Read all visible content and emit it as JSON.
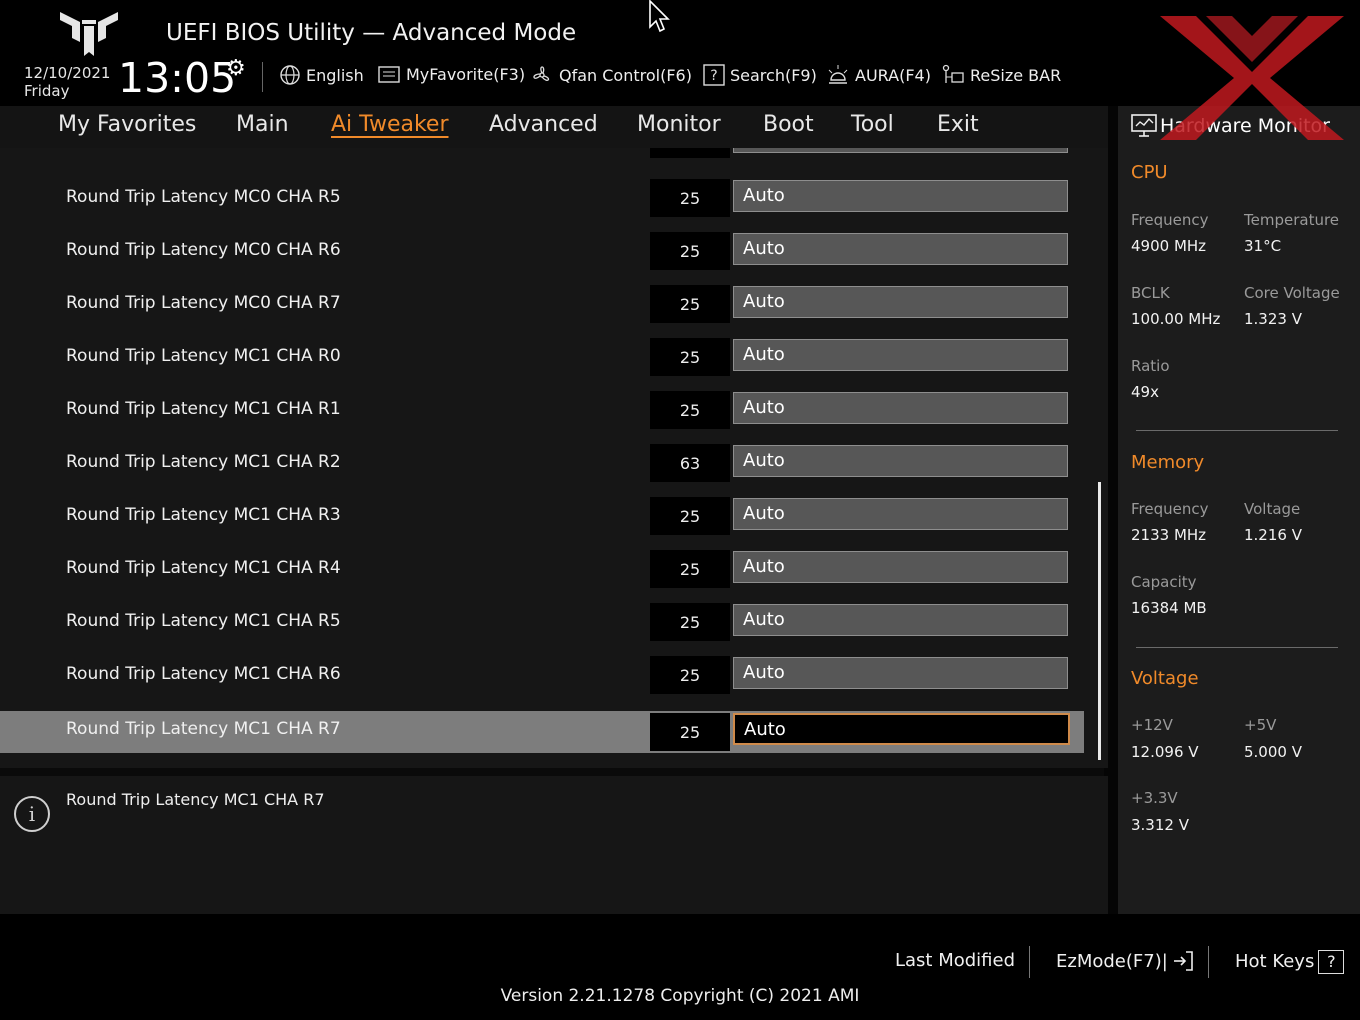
{
  "header": {
    "title": "UEFI BIOS Utility — Advanced Mode",
    "date": "12/10/2021",
    "day": "Friday",
    "time": "13:05",
    "toolbar": [
      {
        "label": "English",
        "icon": "globe-icon"
      },
      {
        "label": "MyFavorite(F3)",
        "icon": "favorite-list-icon"
      },
      {
        "label": "Qfan Control(F6)",
        "icon": "fan-icon"
      },
      {
        "label": "Search(F9)",
        "icon": "search-question-icon"
      },
      {
        "label": "AURA(F4)",
        "icon": "aura-light-icon"
      },
      {
        "label": "ReSize BAR",
        "icon": "resize-bar-icon"
      }
    ]
  },
  "tabs": [
    {
      "label": "My Favorites",
      "active": false
    },
    {
      "label": "Main",
      "active": false
    },
    {
      "label": "Ai Tweaker",
      "active": true
    },
    {
      "label": "Advanced",
      "active": false
    },
    {
      "label": "Monitor",
      "active": false
    },
    {
      "label": "Boot",
      "active": false
    },
    {
      "label": "Tool",
      "active": false
    },
    {
      "label": "Exit",
      "active": false
    }
  ],
  "settings": [
    {
      "label": "Round Trip Latency MC0 CHA R5",
      "current": "25",
      "value": "Auto"
    },
    {
      "label": "Round Trip Latency MC0 CHA R6",
      "current": "25",
      "value": "Auto"
    },
    {
      "label": "Round Trip Latency MC0 CHA R7",
      "current": "25",
      "value": "Auto"
    },
    {
      "label": "Round Trip Latency MC1 CHA R0",
      "current": "25",
      "value": "Auto"
    },
    {
      "label": "Round Trip Latency MC1 CHA R1",
      "current": "25",
      "value": "Auto"
    },
    {
      "label": "Round Trip Latency MC1 CHA R2",
      "current": "63",
      "value": "Auto"
    },
    {
      "label": "Round Trip Latency MC1 CHA R3",
      "current": "25",
      "value": "Auto"
    },
    {
      "label": "Round Trip Latency MC1 CHA R4",
      "current": "25",
      "value": "Auto"
    },
    {
      "label": "Round Trip Latency MC1 CHA R5",
      "current": "25",
      "value": "Auto"
    },
    {
      "label": "Round Trip Latency MC1 CHA R6",
      "current": "25",
      "value": "Auto"
    },
    {
      "label": "Round Trip Latency MC1 CHA R7",
      "current": "25",
      "value": "Auto",
      "selected": true
    }
  ],
  "help_text": "Round Trip Latency MC1 CHA R7",
  "hardware_monitor": {
    "title": "Hardware Monitor",
    "cpu": {
      "heading": "CPU",
      "frequency_label": "Frequency",
      "frequency": "4900 MHz",
      "temperature_label": "Temperature",
      "temperature": "31°C",
      "bclk_label": "BCLK",
      "bclk": "100.00 MHz",
      "core_voltage_label": "Core Voltage",
      "core_voltage": "1.323 V",
      "ratio_label": "Ratio",
      "ratio": "49x"
    },
    "memory": {
      "heading": "Memory",
      "frequency_label": "Frequency",
      "frequency": "2133 MHz",
      "voltage_label": "Voltage",
      "voltage": "1.216 V",
      "capacity_label": "Capacity",
      "capacity": "16384 MB"
    },
    "voltage": {
      "heading": "Voltage",
      "v12_label": "+12V",
      "v12": "12.096 V",
      "v5_label": "+5V",
      "v5": "5.000 V",
      "v33_label": "+3.3V",
      "v33": "3.312 V"
    }
  },
  "footer": {
    "last_modified": "Last Modified",
    "ezmode": "EzMode(F7)|",
    "hotkeys": "Hot Keys",
    "hotkeys_box": "?",
    "version": "Version 2.21.1278 Copyright (C) 2021 AMI"
  },
  "colors": {
    "accent": "#f08a2a",
    "watermark": "#c0191f"
  }
}
